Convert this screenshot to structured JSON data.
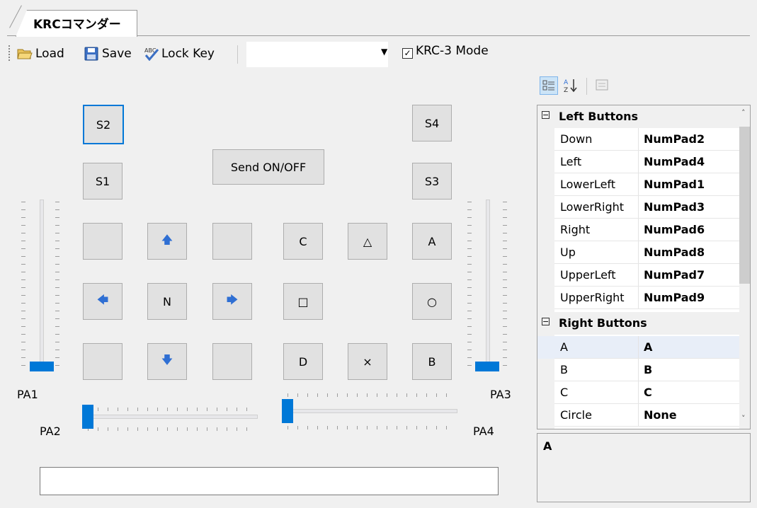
{
  "tab": {
    "label": "KRCコマンダー"
  },
  "toolbar": {
    "load_label": "Load",
    "save_label": "Save",
    "lockkey_label": "Lock Key",
    "combo_value": "",
    "krc3_label": "KRC-3 Mode",
    "krc3_checked": true
  },
  "buttons": {
    "s1": "S1",
    "s2": "S2",
    "s3": "S3",
    "s4": "S4",
    "send": "Send ON/OFF",
    "n": "N",
    "c": "C",
    "a": "A",
    "d": "D",
    "b": "B",
    "triangle": "△",
    "square": "□",
    "circle": "○",
    "cross": "×"
  },
  "sliders": {
    "pa1": "PA1",
    "pa2": "PA2",
    "pa3": "PA3",
    "pa4": "PA4"
  },
  "status": {
    "value": ""
  },
  "property_grid": {
    "categories": [
      {
        "label": "Left Buttons",
        "items": [
          {
            "name": "Down",
            "value": "NumPad2"
          },
          {
            "name": "Left",
            "value": "NumPad4"
          },
          {
            "name": "LowerLeft",
            "value": "NumPad1"
          },
          {
            "name": "LowerRight",
            "value": "NumPad3"
          },
          {
            "name": "Right",
            "value": "NumPad6"
          },
          {
            "name": "Up",
            "value": "NumPad8"
          },
          {
            "name": "UpperLeft",
            "value": "NumPad7"
          },
          {
            "name": "UpperRight",
            "value": "NumPad9"
          }
        ]
      },
      {
        "label": "Right Buttons",
        "items": [
          {
            "name": "A",
            "value": "A"
          },
          {
            "name": "B",
            "value": "B"
          },
          {
            "name": "C",
            "value": "C"
          },
          {
            "name": "Circle",
            "value": "None"
          }
        ]
      }
    ],
    "description_title": "A"
  },
  "colors": {
    "accent": "#0078d7",
    "button": "#e1e1e1",
    "background": "#f0f0f0"
  }
}
